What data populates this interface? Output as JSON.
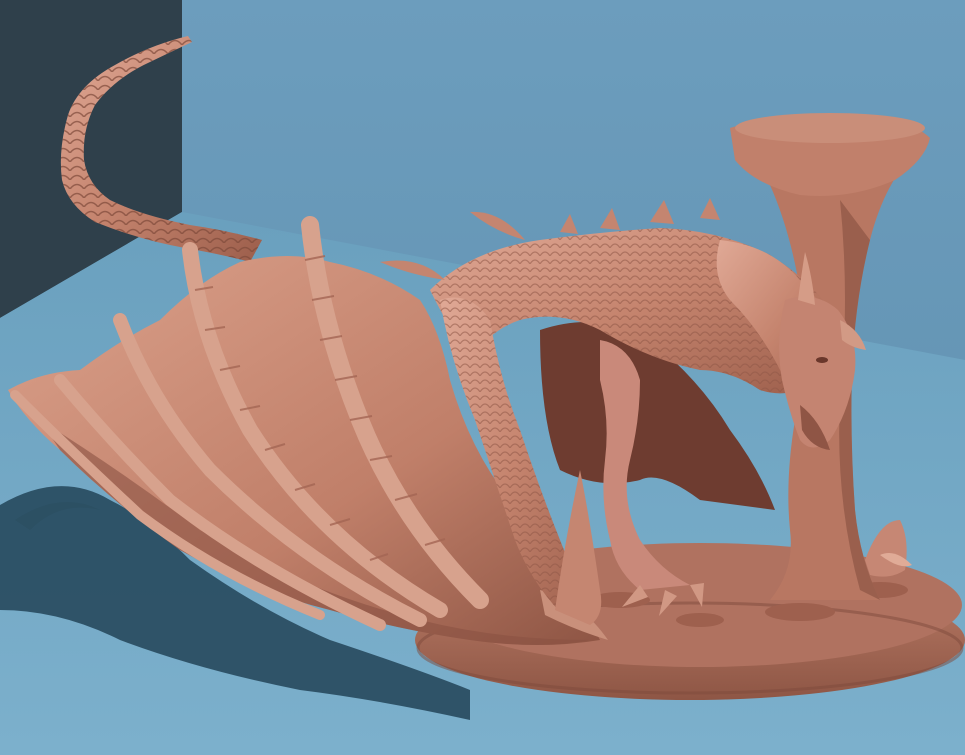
{
  "scene": {
    "subject": "dragon-miniature-sculpt",
    "colors": {
      "back_wall": "#6a9bbb",
      "left_wall": "#2e3f4a",
      "floor": "#73a7c4",
      "shadow": "#284a5e",
      "model_light": "#d9a08a",
      "model_mid": "#c0806a",
      "model_dark": "#8a5443",
      "model_deep": "#5e3328"
    }
  }
}
